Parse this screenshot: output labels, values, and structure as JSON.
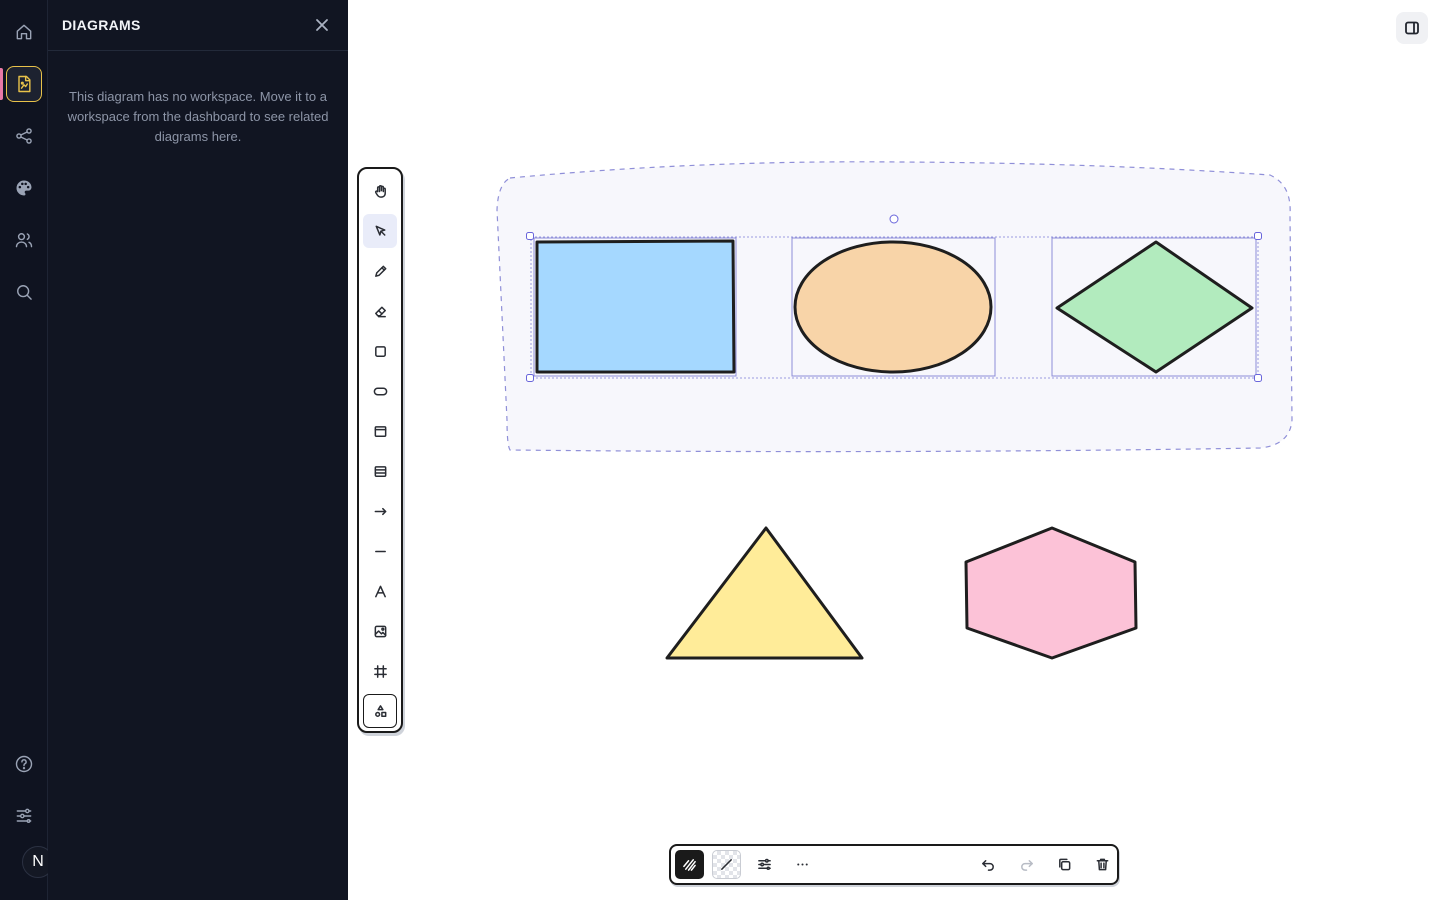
{
  "panel": {
    "title": "DIAGRAMS",
    "empty_message": "This diagram has no workspace. Move it to a workspace from the dashboard to see related diagrams here."
  },
  "rail": {
    "items": [
      "home-icon",
      "diagram-icon",
      "share-icon",
      "palette-icon",
      "users-icon",
      "search-icon"
    ],
    "bottom_items": [
      "help-icon",
      "sliders-icon"
    ],
    "active_item": "diagram-icon",
    "avatar_initial": "N"
  },
  "tools": [
    "hand-icon",
    "pointer-icon",
    "pencil-icon",
    "eraser-icon",
    "rectangle-icon",
    "ellipse-icon",
    "frame-icon",
    "table-icon",
    "arrow-icon",
    "line-icon",
    "text-icon",
    "image-icon",
    "frame-grid-icon",
    "shapes-icon"
  ],
  "active_tool": "pointer-icon",
  "actions": [
    "stroke-style-icon",
    "fill-style-icon",
    "adjust-icon",
    "more-icon",
    "undo-icon",
    "redo-icon",
    "duplicate-icon",
    "delete-icon"
  ],
  "canvas": {
    "shapes": [
      {
        "kind": "rectangle",
        "fill": "#a5d8ff",
        "selected": true
      },
      {
        "kind": "ellipse",
        "fill": "#f8d4a8",
        "selected": true
      },
      {
        "kind": "diamond",
        "fill": "#b2ebbe",
        "selected": true
      },
      {
        "kind": "triangle",
        "fill": "#ffec99"
      },
      {
        "kind": "hexagon",
        "fill": "#fcc2d7"
      }
    ],
    "group_region_fill": "#f7f7fc",
    "selection_color": "#6965db"
  },
  "colors": {
    "rail_bg": "#0f1320",
    "panel_bg": "#111522",
    "active_accent": "#e8c24a",
    "indicator": "#e879a6"
  }
}
